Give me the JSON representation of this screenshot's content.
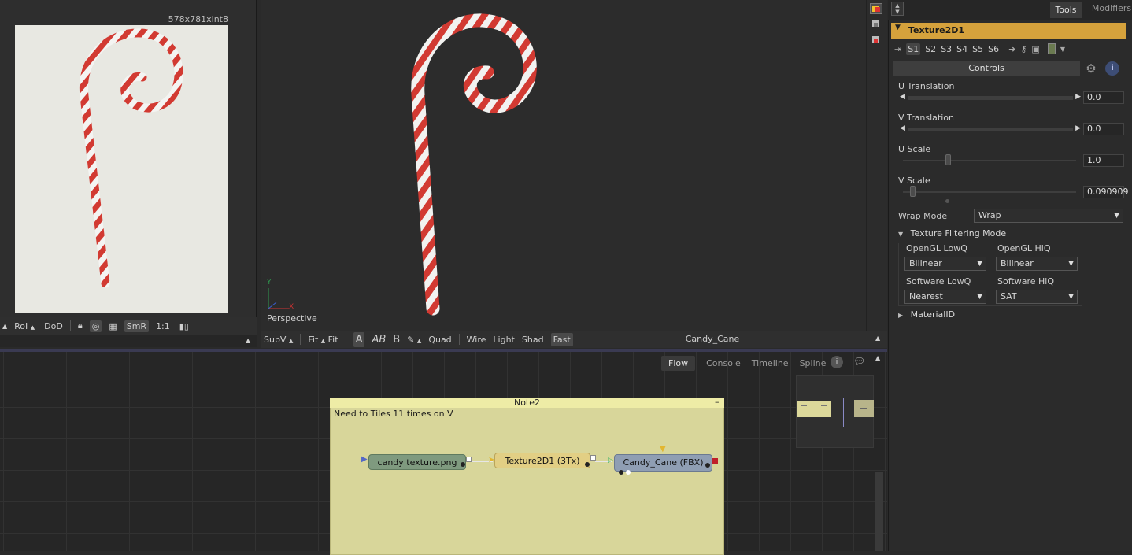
{
  "left_viewer": {
    "resolution": "578x781xint8",
    "toolbar": {
      "roi": "RoI",
      "dod": "DoD",
      "smr": "SmR",
      "ratio": "1:1"
    }
  },
  "viewer3d": {
    "axis_x": "X",
    "axis_y": "Y",
    "perspective_label": "Perspective",
    "scene_name": "Candy_Cane",
    "toolbar": {
      "subv": "SubV",
      "fit1": "Fit",
      "fit2": "Fit",
      "a_label": "A",
      "ab_label": "AB",
      "b_label": "B",
      "quad": "Quad",
      "wire": "Wire",
      "light": "Light",
      "shad": "Shad",
      "fast": "Fast"
    }
  },
  "inspector": {
    "tabs": {
      "tools": "Tools",
      "modifiers": "Modifiers"
    },
    "tool_name": "Texture2D1",
    "slots": [
      "S1",
      "S2",
      "S3",
      "S4",
      "S5",
      "S6"
    ],
    "controls_label": "Controls",
    "u_translation": {
      "label": "U Translation",
      "value": "0.0"
    },
    "v_translation": {
      "label": "V Translation",
      "value": "0.0"
    },
    "u_scale": {
      "label": "U Scale",
      "value": "1.0",
      "level": 0.25
    },
    "v_scale": {
      "label": "V Scale",
      "value": "0.090909",
      "level": 0.04
    },
    "wrap_mode": {
      "label": "Wrap Mode",
      "value": "Wrap"
    },
    "texture_filtering": {
      "header": "Texture Filtering Mode",
      "opengl_lowq": {
        "label": "OpenGL LowQ",
        "value": "Bilinear"
      },
      "opengl_hiq": {
        "label": "OpenGL HiQ",
        "value": "Bilinear"
      },
      "software_lowq": {
        "label": "Software LowQ",
        "value": "Nearest"
      },
      "software_hiq": {
        "label": "Software HiQ",
        "value": "SAT"
      }
    },
    "material_id": "MaterialID"
  },
  "flow": {
    "tabs": {
      "flow": "Flow",
      "console": "Console",
      "timeline": "Timeline",
      "spline": "Spline"
    },
    "note": {
      "title": "Note2",
      "text": "Need to Tiles 11 times on V"
    },
    "nodes": {
      "loader": "candy texture.png",
      "texture": "Texture2D1  (3Tx)",
      "fbx": "Candy_Cane  (FBX)"
    }
  },
  "colors": {
    "tool_header": "#d6a23c",
    "note_bg": "#d8d69a",
    "loader_node": "#7f9a7f",
    "texture_node": "#e2cf84",
    "fbx_node": "#8f9eb3",
    "candy_red": "#d23a32"
  }
}
